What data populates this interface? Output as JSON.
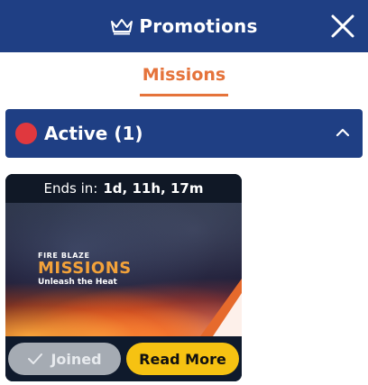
{
  "header": {
    "title": "Promotions",
    "icon": "crown-icon",
    "close_icon": "close-icon"
  },
  "tabs": [
    {
      "label": "Missions",
      "active": true
    }
  ],
  "section": {
    "title": "Active (1)",
    "status_color": "#e0383e",
    "expanded": true
  },
  "card": {
    "ends_label": "Ends in:",
    "ends_value": "1d, 11h, 17m",
    "banner": {
      "subtitle": "FIRE BLAZE",
      "title": "MISSIONS",
      "tagline": "Unleash the Heat"
    },
    "joined_label": "Joined",
    "read_more_label": "Read More"
  },
  "colors": {
    "brand_blue": "#1f3f84",
    "accent_orange": "#e5733b",
    "button_yellow": "#f6c212"
  }
}
